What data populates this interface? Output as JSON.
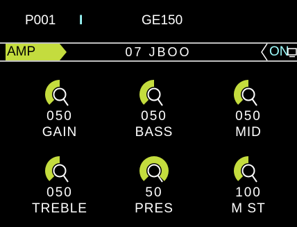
{
  "header": {
    "preset_number": "P001",
    "divider": "I",
    "device_name": "GE150"
  },
  "module_bar": {
    "module_label": "AMP",
    "model_name": "07 JBOO",
    "status": "ON",
    "status_icon": "screen-icon"
  },
  "colors": {
    "background": "#000000",
    "accent_green": "#c4dc3e",
    "status_cyan": "#9dfcfc",
    "text": "#ffffff"
  },
  "knobs": [
    {
      "label": "GAIN",
      "value": "050",
      "level": 0.5
    },
    {
      "label": "BASS",
      "value": "050",
      "level": 0.5
    },
    {
      "label": "MID",
      "value": "050",
      "level": 0.5
    },
    {
      "label": "TREBLE",
      "value": "050",
      "level": 0.5
    },
    {
      "label": "PRES",
      "value": "50",
      "level": 1.0
    },
    {
      "label": "M ST",
      "value": "100",
      "level": 0.5
    }
  ]
}
